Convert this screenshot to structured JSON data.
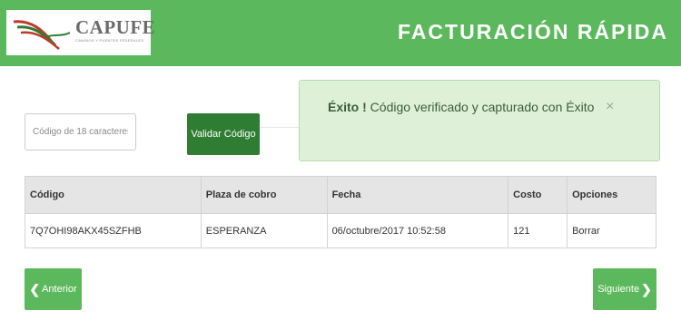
{
  "header": {
    "logo_text": "CAPUFE",
    "logo_subtext": "CAMINOS Y PUENTES FEDERALES",
    "title": "FACTURACIÓN RÁPIDA",
    "colors": {
      "header_bg": "#5cb85c",
      "logo_red": "#c0392b",
      "logo_green": "#2e7d32"
    }
  },
  "alert": {
    "strong_text": "Éxito !",
    "message": " Código verificado y capturado con Éxito",
    "close_symbol": "×",
    "colors": {
      "bg": "#dff0d8",
      "border": "#b9d9ab"
    }
  },
  "form": {
    "code_input": {
      "placeholder": "Código de 18 caracteres",
      "value": ""
    },
    "validate_label": "Validar Código"
  },
  "table": {
    "headers": [
      "Código",
      "Plaza de cobro",
      "Fecha",
      "Costo",
      "Opciones"
    ],
    "rows": [
      [
        "7Q7OHI98AKX45SZFHB",
        "ESPERANZA",
        "06/octubre/2017 10:52:58",
        "121",
        "Borrar"
      ]
    ]
  },
  "nav": {
    "prev_label": "Anterior",
    "next_label": "Siguiente",
    "prev_icon": "chevron-left-icon",
    "next_icon": "chevron-right-icon",
    "prev_glyph": "❮",
    "next_glyph": "❯"
  }
}
